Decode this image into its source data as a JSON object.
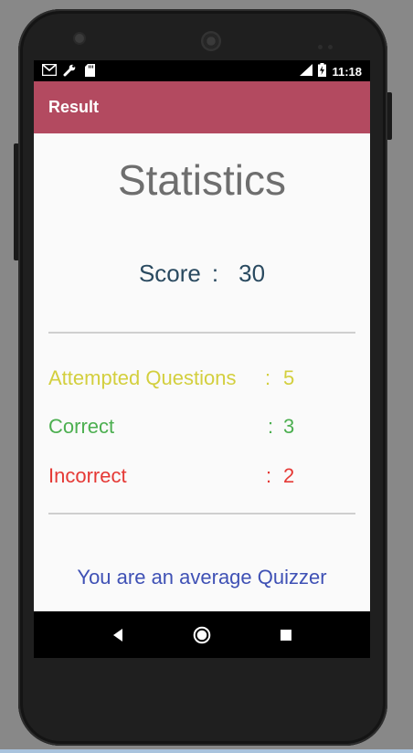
{
  "status_bar": {
    "time": "11:18",
    "left_icons": [
      "gmail-icon",
      "wrench-icon",
      "sd-card-icon"
    ],
    "right_icons": [
      "signal-icon",
      "battery-charging-icon"
    ]
  },
  "toolbar": {
    "title": "Result",
    "color": "#b34a60"
  },
  "main": {
    "heading": "Statistics",
    "score": {
      "label": "Score",
      "separator": ":",
      "value": "30"
    },
    "stats": [
      {
        "label": "Attempted Questions",
        "separator": ":",
        "value": "5",
        "color": "#d3cf3e"
      },
      {
        "label": "Correct",
        "separator": ":",
        "value": "3",
        "color": "#4caf50"
      },
      {
        "label": "Incorrect",
        "separator": ":",
        "value": "2",
        "color": "#e53935"
      }
    ],
    "verdict": "You are an average Quizzer"
  },
  "nav_bar": {
    "buttons": [
      "back-icon",
      "home-icon",
      "recents-icon"
    ]
  }
}
